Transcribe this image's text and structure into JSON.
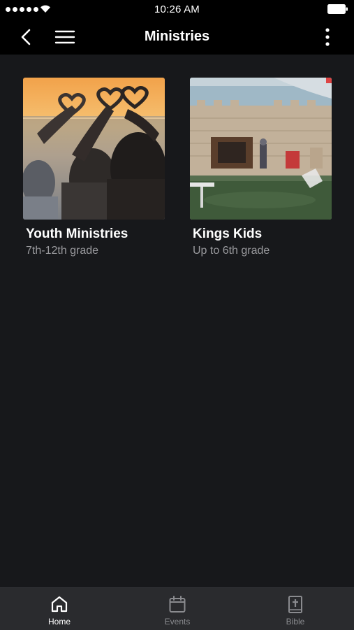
{
  "status_bar": {
    "time": "10:26 AM",
    "icons": [
      "signal-dots-icon",
      "wifi-icon",
      "battery-icon"
    ]
  },
  "nav": {
    "title": "Ministries",
    "icons": [
      "back-chevron-icon",
      "hamburger-menu-icon",
      "more-vertical-icon"
    ]
  },
  "ministries": [
    {
      "title": "Youth Ministries",
      "subtitle": "7th-12th grade",
      "image": "heart-hands-sunset-photo"
    },
    {
      "title": "Kings Kids",
      "subtitle": "Up to 6th grade",
      "image": "castle-themed-kids-room-photo"
    }
  ],
  "tabs": [
    {
      "label": "Home",
      "icon": "home-icon",
      "active": true
    },
    {
      "label": "Events",
      "icon": "calendar-icon",
      "active": false
    },
    {
      "label": "Bible",
      "icon": "bible-icon",
      "active": false
    }
  ],
  "colors": {
    "background": "#17181b",
    "header": "#000000",
    "tab_bar": "#2a2b2e",
    "subtitle": "#9a9a9e",
    "tab_inactive": "#8a8b8f"
  }
}
